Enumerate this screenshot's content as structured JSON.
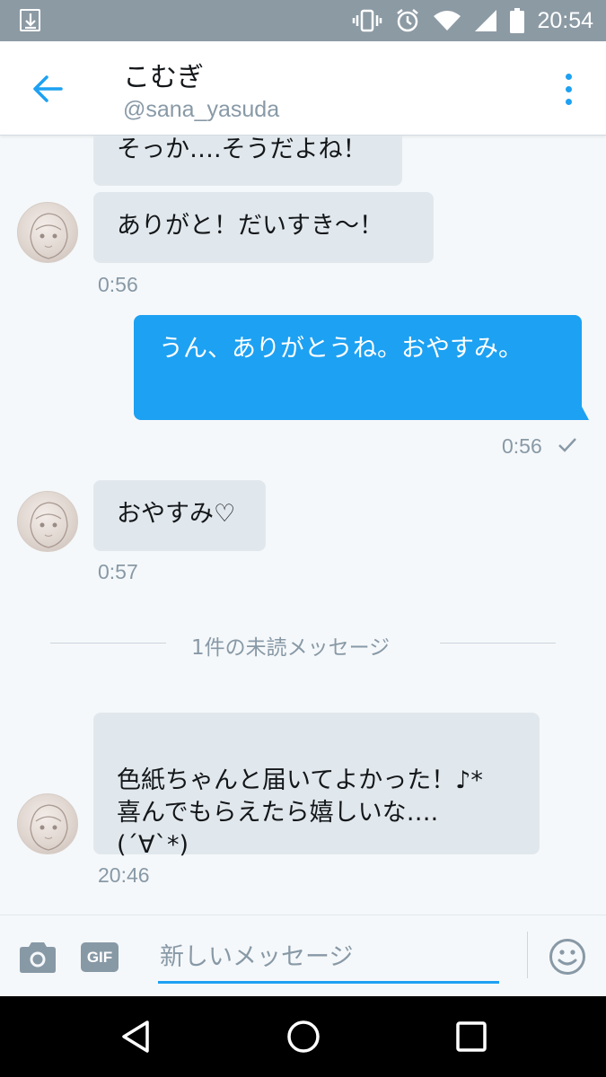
{
  "status_bar": {
    "time": "20:54",
    "icons": [
      "download-icon",
      "vibrate-icon",
      "alarm-icon",
      "wifi-icon",
      "signal-icon",
      "battery-icon"
    ]
  },
  "header": {
    "name": "こむぎ",
    "handle": "@sana_yasuda",
    "icons": [
      "back-arrow-icon",
      "more-vertical-icon"
    ]
  },
  "messages": [
    {
      "text": "そっか….そうだよね！",
      "direction": "incoming"
    },
    {
      "text": "ありがと！だいすき〜！",
      "direction": "incoming"
    },
    {
      "time": "0:56"
    },
    {
      "text": "うん、ありがとうね。おやすみ。",
      "direction": "outgoing"
    },
    {
      "time": "0:56",
      "status": "check-icon"
    },
    {
      "text": "おやすみ♡",
      "direction": "incoming"
    },
    {
      "time": "0:57"
    },
    {
      "divider": "1件の未読メッセージ"
    },
    {
      "text": "色紙ちゃんと届いてよかった！♪*\n喜んでもらえたら嬉しいな….\n(´∀`*)",
      "direction": "incoming"
    },
    {
      "time": "20:46"
    }
  ],
  "composer": {
    "placeholder": "新しいメッセージ",
    "gif_label": "GIF",
    "icons": [
      "camera-icon",
      "gif-icon",
      "emoji-icon"
    ]
  },
  "nav_bar": {
    "icons": [
      "back-triangle-icon",
      "home-circle-icon",
      "recents-square-icon"
    ]
  },
  "colors": {
    "accent": "#1da1f2",
    "incoming_bubble": "#e1e8ed",
    "status_bar": "#8c9aa4",
    "background": "#f5f8fa",
    "muted_text": "#8899a6"
  }
}
